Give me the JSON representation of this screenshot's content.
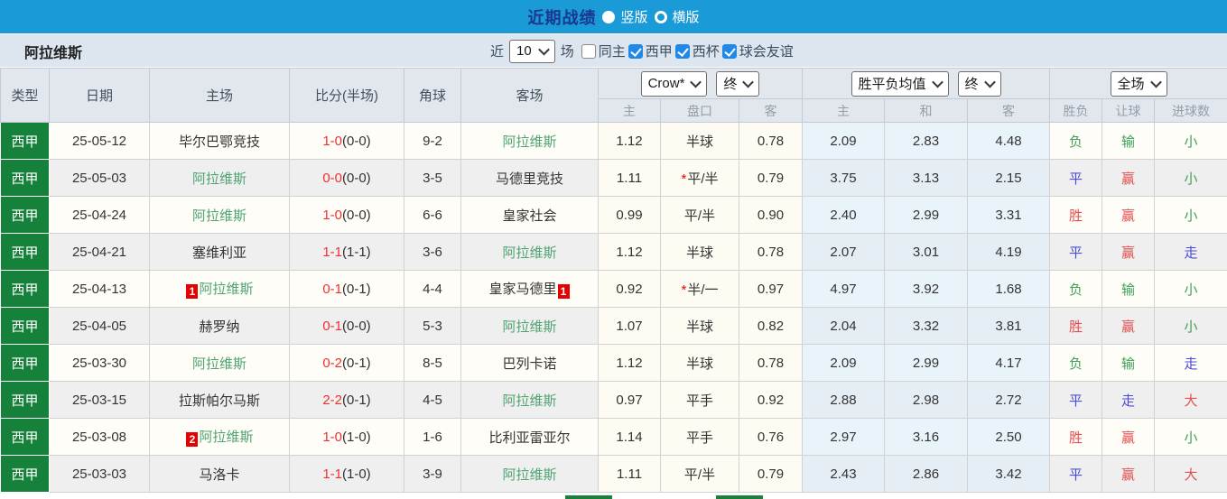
{
  "topbar": {
    "title": "近期战绩",
    "layout_options": [
      {
        "label": "竖版",
        "selected": true
      },
      {
        "label": "横版",
        "selected": false
      }
    ]
  },
  "filterbar": {
    "team_name": "阿拉维斯",
    "recent_label": "近",
    "recent_count": "10",
    "unit_label": "场",
    "checkboxes": [
      {
        "label": "同主",
        "checked": false
      },
      {
        "label": "西甲",
        "checked": true
      },
      {
        "label": "西杯",
        "checked": true
      },
      {
        "label": "球会友谊",
        "checked": true
      }
    ]
  },
  "table": {
    "main_headers": [
      "类型",
      "日期",
      "主场",
      "比分(半场)",
      "角球",
      "客场"
    ],
    "dropdowns": {
      "odds_source": "Crow*",
      "odds_stage": "终",
      "avg_label": "胜平负均值",
      "avg_stage": "终",
      "period": "全场"
    },
    "sub_headers": [
      "主",
      "盘口",
      "客",
      "主",
      "和",
      "客",
      "胜负",
      "让球",
      "进球数"
    ],
    "rows": [
      {
        "league": "西甲",
        "date": "25-05-12",
        "home": {
          "name": "毕尔巴鄂竞技",
          "green": false,
          "badge": ""
        },
        "score": {
          "ft": "1-0",
          "ht": "(0-0)"
        },
        "corners": "9-2",
        "away": {
          "name": "阿拉维斯",
          "green": true,
          "badge": ""
        },
        "crow": {
          "home": "1.12",
          "handicap": "半球",
          "star": false,
          "away": "0.78"
        },
        "avg": {
          "home": "2.09",
          "draw": "2.83",
          "away": "4.48"
        },
        "outcome": {
          "text": "负",
          "color": "green"
        },
        "handicap_result": {
          "text": "输",
          "color": "green"
        },
        "goals_result": {
          "text": "小",
          "color": "green"
        }
      },
      {
        "league": "西甲",
        "date": "25-05-03",
        "home": {
          "name": "阿拉维斯",
          "green": true,
          "badge": ""
        },
        "score": {
          "ft": "0-0",
          "ht": "(0-0)"
        },
        "corners": "3-5",
        "away": {
          "name": "马德里竞技",
          "green": false,
          "badge": ""
        },
        "crow": {
          "home": "1.11",
          "handicap": "平/半",
          "star": true,
          "away": "0.79"
        },
        "avg": {
          "home": "3.75",
          "draw": "3.13",
          "away": "2.15"
        },
        "outcome": {
          "text": "平",
          "color": "blue"
        },
        "handicap_result": {
          "text": "赢",
          "color": "red"
        },
        "goals_result": {
          "text": "小",
          "color": "green"
        }
      },
      {
        "league": "西甲",
        "date": "25-04-24",
        "home": {
          "name": "阿拉维斯",
          "green": true,
          "badge": ""
        },
        "score": {
          "ft": "1-0",
          "ht": "(0-0)"
        },
        "corners": "6-6",
        "away": {
          "name": "皇家社会",
          "green": false,
          "badge": ""
        },
        "crow": {
          "home": "0.99",
          "handicap": "平/半",
          "star": false,
          "away": "0.90"
        },
        "avg": {
          "home": "2.40",
          "draw": "2.99",
          "away": "3.31"
        },
        "outcome": {
          "text": "胜",
          "color": "red"
        },
        "handicap_result": {
          "text": "赢",
          "color": "red"
        },
        "goals_result": {
          "text": "小",
          "color": "green"
        }
      },
      {
        "league": "西甲",
        "date": "25-04-21",
        "home": {
          "name": "塞维利亚",
          "green": false,
          "badge": ""
        },
        "score": {
          "ft": "1-1",
          "ht": "(1-1)"
        },
        "corners": "3-6",
        "away": {
          "name": "阿拉维斯",
          "green": true,
          "badge": ""
        },
        "crow": {
          "home": "1.12",
          "handicap": "半球",
          "star": false,
          "away": "0.78"
        },
        "avg": {
          "home": "2.07",
          "draw": "3.01",
          "away": "4.19"
        },
        "outcome": {
          "text": "平",
          "color": "blue"
        },
        "handicap_result": {
          "text": "赢",
          "color": "red"
        },
        "goals_result": {
          "text": "走",
          "color": "blue"
        }
      },
      {
        "league": "西甲",
        "date": "25-04-13",
        "home": {
          "name": "阿拉维斯",
          "green": true,
          "badge": "1"
        },
        "score": {
          "ft": "0-1",
          "ht": "(0-1)"
        },
        "corners": "4-4",
        "away": {
          "name": "皇家马德里",
          "green": false,
          "badge": "1"
        },
        "crow": {
          "home": "0.92",
          "handicap": "半/一",
          "star": true,
          "away": "0.97"
        },
        "avg": {
          "home": "4.97",
          "draw": "3.92",
          "away": "1.68"
        },
        "outcome": {
          "text": "负",
          "color": "green"
        },
        "handicap_result": {
          "text": "输",
          "color": "green"
        },
        "goals_result": {
          "text": "小",
          "color": "green"
        }
      },
      {
        "league": "西甲",
        "date": "25-04-05",
        "home": {
          "name": "赫罗纳",
          "green": false,
          "badge": ""
        },
        "score": {
          "ft": "0-1",
          "ht": "(0-0)"
        },
        "corners": "5-3",
        "away": {
          "name": "阿拉维斯",
          "green": true,
          "badge": ""
        },
        "crow": {
          "home": "1.07",
          "handicap": "半球",
          "star": false,
          "away": "0.82"
        },
        "avg": {
          "home": "2.04",
          "draw": "3.32",
          "away": "3.81"
        },
        "outcome": {
          "text": "胜",
          "color": "red"
        },
        "handicap_result": {
          "text": "赢",
          "color": "red"
        },
        "goals_result": {
          "text": "小",
          "color": "green"
        }
      },
      {
        "league": "西甲",
        "date": "25-03-30",
        "home": {
          "name": "阿拉维斯",
          "green": true,
          "badge": ""
        },
        "score": {
          "ft": "0-2",
          "ht": "(0-1)"
        },
        "corners": "8-5",
        "away": {
          "name": "巴列卡诺",
          "green": false,
          "badge": ""
        },
        "crow": {
          "home": "1.12",
          "handicap": "半球",
          "star": false,
          "away": "0.78"
        },
        "avg": {
          "home": "2.09",
          "draw": "2.99",
          "away": "4.17"
        },
        "outcome": {
          "text": "负",
          "color": "green"
        },
        "handicap_result": {
          "text": "输",
          "color": "green"
        },
        "goals_result": {
          "text": "走",
          "color": "blue"
        }
      },
      {
        "league": "西甲",
        "date": "25-03-15",
        "home": {
          "name": "拉斯帕尔马斯",
          "green": false,
          "badge": ""
        },
        "score": {
          "ft": "2-2",
          "ht": "(0-1)"
        },
        "corners": "4-5",
        "away": {
          "name": "阿拉维斯",
          "green": true,
          "badge": ""
        },
        "crow": {
          "home": "0.97",
          "handicap": "平手",
          "star": false,
          "away": "0.92"
        },
        "avg": {
          "home": "2.88",
          "draw": "2.98",
          "away": "2.72"
        },
        "outcome": {
          "text": "平",
          "color": "blue"
        },
        "handicap_result": {
          "text": "走",
          "color": "blue"
        },
        "goals_result": {
          "text": "大",
          "color": "red"
        }
      },
      {
        "league": "西甲",
        "date": "25-03-08",
        "home": {
          "name": "阿拉维斯",
          "green": true,
          "badge": "2"
        },
        "score": {
          "ft": "1-0",
          "ht": "(1-0)"
        },
        "corners": "1-6",
        "away": {
          "name": "比利亚雷亚尔",
          "green": false,
          "badge": ""
        },
        "crow": {
          "home": "1.14",
          "handicap": "平手",
          "star": false,
          "away": "0.76"
        },
        "avg": {
          "home": "2.97",
          "draw": "3.16",
          "away": "2.50"
        },
        "outcome": {
          "text": "胜",
          "color": "red"
        },
        "handicap_result": {
          "text": "赢",
          "color": "red"
        },
        "goals_result": {
          "text": "小",
          "color": "green"
        }
      },
      {
        "league": "西甲",
        "date": "25-03-03",
        "home": {
          "name": "马洛卡",
          "green": false,
          "badge": ""
        },
        "score": {
          "ft": "1-1",
          "ht": "(1-0)"
        },
        "corners": "3-9",
        "away": {
          "name": "阿拉维斯",
          "green": true,
          "badge": ""
        },
        "crow": {
          "home": "1.11",
          "handicap": "平/半",
          "star": false,
          "away": "0.79"
        },
        "avg": {
          "home": "2.43",
          "draw": "2.86",
          "away": "3.42"
        },
        "outcome": {
          "text": "平",
          "color": "blue"
        },
        "handicap_result": {
          "text": "赢",
          "color": "red"
        },
        "goals_result": {
          "text": "大",
          "color": "red"
        }
      }
    ]
  },
  "colors": {
    "topbar_bg": "#1a9ad6",
    "title_text": "#17398f",
    "league_green": "#15813a",
    "team_green": "#4fa370",
    "score_red": "#f03030",
    "badge_red": "#e60000",
    "result_red": "#e34f4f",
    "result_green": "#3fa057",
    "result_blue": "#4b4bdb",
    "checkbox_blue": "#1f88e8",
    "avg_col_bg": "#e9f3fa",
    "crow_col_bg": "#fdfbf2",
    "stripe_bg": "#efefef",
    "filter_bg": "#dde6ef",
    "header_bg": "#e2e7ee"
  }
}
